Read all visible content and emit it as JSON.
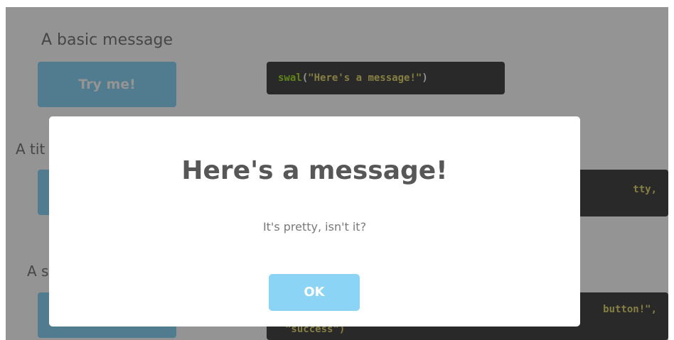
{
  "examples": [
    {
      "label": "A basic message",
      "button_label": "Try me!",
      "code_fn": "swal",
      "code_open": "(",
      "code_str": "\"Here's a message!\"",
      "code_close": ")"
    },
    {
      "label_partial": "A tit",
      "code_visible": "tty,"
    },
    {
      "label_partial": "A s",
      "code_line1": "button!\",",
      "code_line2": "\"success\")"
    }
  ],
  "modal": {
    "title": "Here's a message!",
    "text": "It's pretty, isn't it?",
    "confirm_label": "OK"
  },
  "colors": {
    "button": "#8cd4f5",
    "code_background": "#474747",
    "code_function": "#a6e22e",
    "code_string": "#e6db74",
    "title": "#575757",
    "text": "#797979"
  }
}
